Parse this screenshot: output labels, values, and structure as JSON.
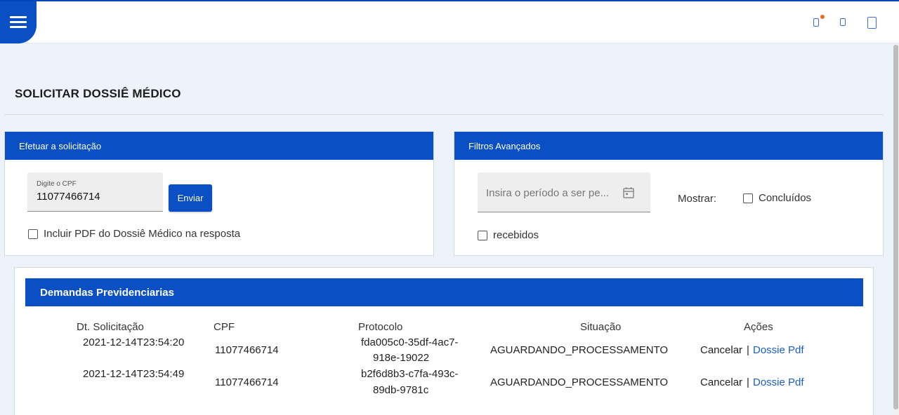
{
  "page": {
    "title": "SOLICITAR DOSSIÊ MÉDICO"
  },
  "header": {
    "menu_icon": "hamburger-menu-icon"
  },
  "solicitacao": {
    "header": "Efetuar a solicitação",
    "cpf_label": "Digite o CPF",
    "cpf_value": "11077466714",
    "send_label": "Enviar",
    "include_pdf_label": "Incluir PDF do Dossiê Médico na resposta"
  },
  "filtros": {
    "header": "Filtros Avançados",
    "period_placeholder": "Insira o período a ser pe...",
    "mostrar_label": "Mostrar:",
    "concluidos_label": "Concluídos",
    "recebidos_label": "recebidos"
  },
  "demandas": {
    "header": "Demandas Previdenciarias",
    "columns": [
      "Dt. Solicitação",
      "CPF",
      "Protocolo",
      "Situação",
      "Ações"
    ],
    "rows": [
      {
        "date": "2021-12-14T23:54:20",
        "cpf": "11077466714",
        "protocol_line1": "fda005c0-35df-4ac7-",
        "protocol_line2": "918e-19022",
        "status": "AGUARDANDO_PROCESSAMENTO",
        "cancel": "Cancelar",
        "separator": "|",
        "dossie": "Dossie Pdf"
      },
      {
        "date": "2021-12-14T23:54:49",
        "cpf": "11077466714",
        "protocol_line1": "b2f6d8b3-c7fa-493c-",
        "protocol_line2": "89db-9781c",
        "status": "AGUARDANDO_PROCESSAMENTO",
        "cancel": "Cancelar",
        "separator": "|",
        "dossie": "Dossie Pdf"
      }
    ]
  },
  "colors": {
    "primary": "#0a4fc4",
    "link": "#1a5dc9",
    "notification_dot": "#f06a1b",
    "background": "#eef2fb"
  }
}
